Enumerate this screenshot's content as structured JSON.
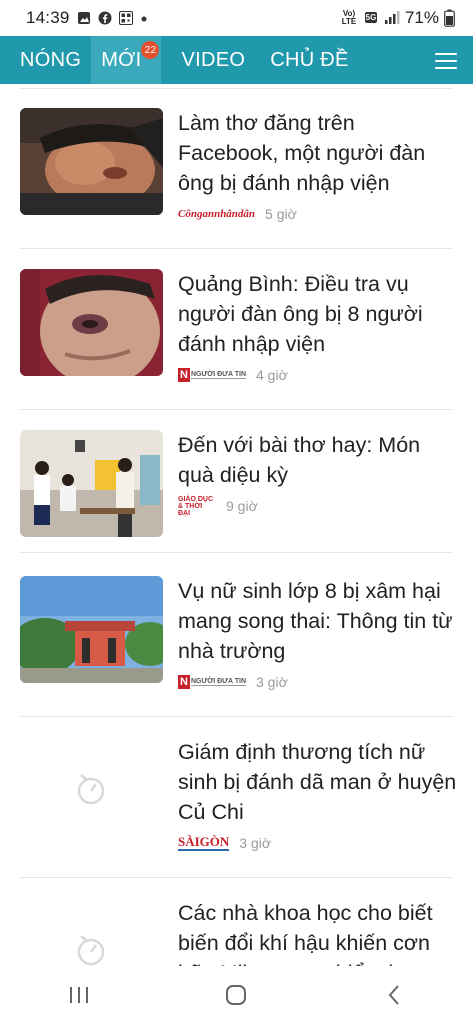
{
  "status_bar": {
    "time": "14:39",
    "battery": "71%",
    "network": "5G",
    "volte": "Vo) LTE",
    "icons": [
      "gallery-icon",
      "facebook-icon",
      "qr-icon",
      "dot-icon",
      "signal-icon",
      "battery-icon"
    ]
  },
  "nav": {
    "tabs": [
      {
        "label": "NÓNG"
      },
      {
        "label": "MỚI",
        "badge": "22"
      },
      {
        "label": "VIDEO"
      },
      {
        "label": "CHỦ ĐỀ"
      }
    ],
    "menu_icon": "hamburger-icon"
  },
  "articles": [
    {
      "title": "Làm thơ đăng trên Facebook, một người đàn ông bị đánh nhập viện",
      "source": "Côngannhândân",
      "time": "5 giờ",
      "thumb": "photo"
    },
    {
      "title": "Quảng Bình: Điều tra vụ người đàn ông bị 8 người đánh nhập viện",
      "source": "NGƯỜI ĐƯA TIN",
      "time": "4 giờ",
      "thumb": "photo"
    },
    {
      "title": "Đến với bài thơ hay: Món quà diệu kỳ",
      "source": "GIÁO DỤC & THỜI ĐẠI",
      "time": "9 giờ",
      "thumb": "photo"
    },
    {
      "title": "Vụ nữ sinh lớp 8 bị xâm hại mang song thai: Thông tin từ nhà trường",
      "source": "NGƯỜI ĐƯA TIN",
      "time": "3 giờ",
      "thumb": "photo"
    },
    {
      "title": "Giám định thương tích nữ sinh bị đánh dã man ở huyện Củ Chi",
      "source": "SÀIGÒN",
      "time": "3 giờ",
      "thumb": "loading"
    },
    {
      "title": "Các nhà khoa học cho biết biến đổi khí hậu khiến cơn bão Milton nguy hiểm hơn",
      "source": "",
      "time": "",
      "thumb": "loading"
    }
  ],
  "colors": {
    "nav_bg": "#2199ad",
    "nav_active": "#3aa9bb",
    "badge": "#e3502d",
    "source_red": "#c8202a"
  },
  "bottom_nav": [
    "recents-icon",
    "home-icon",
    "back-icon"
  ]
}
